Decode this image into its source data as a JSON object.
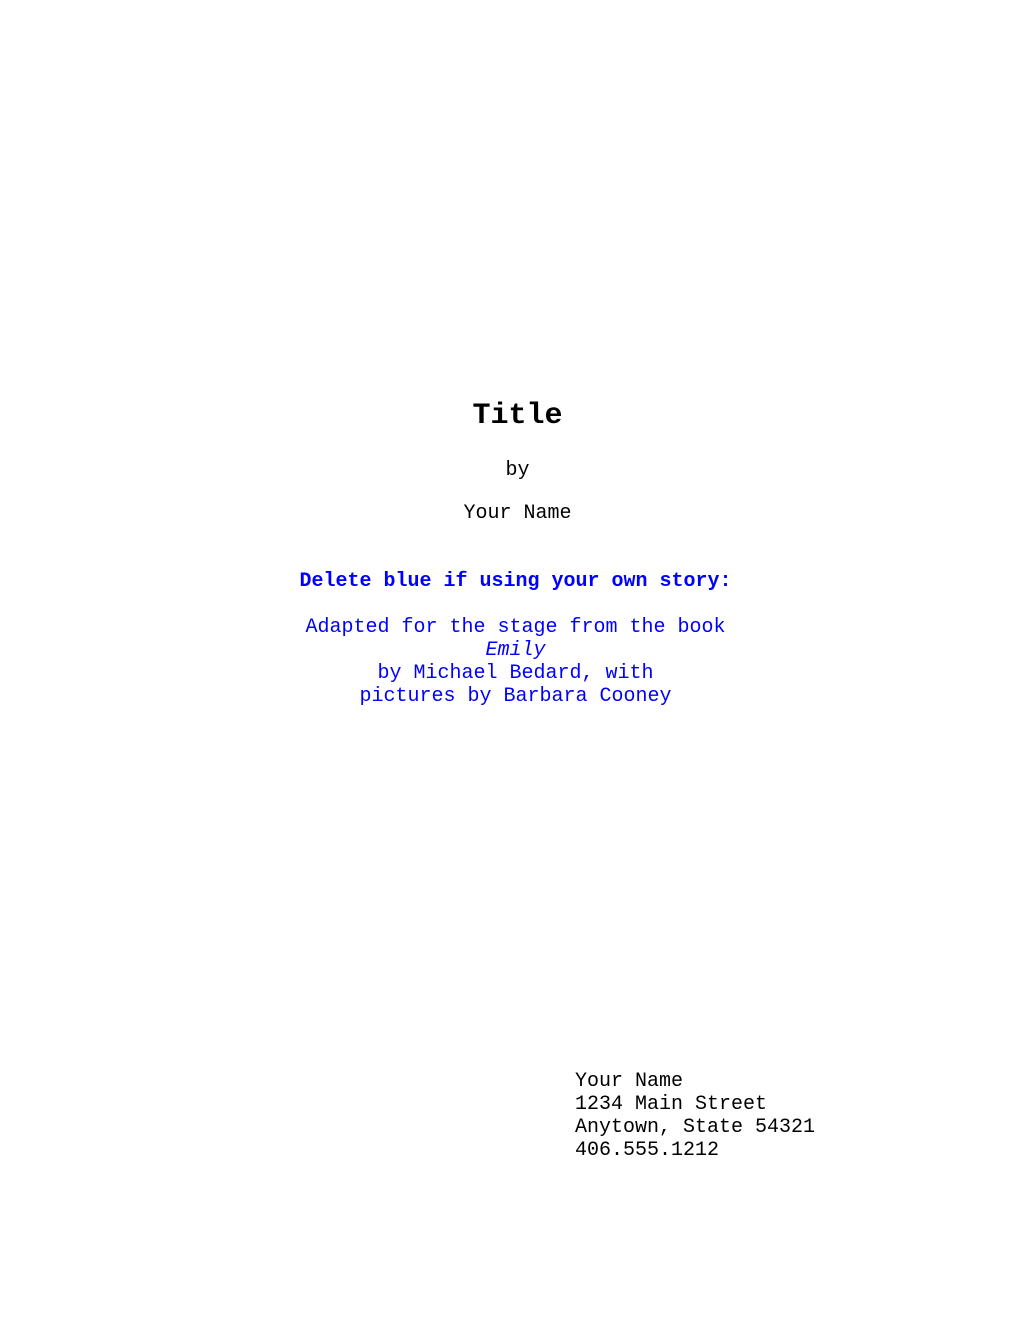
{
  "document": {
    "background_color": "#ffffff",
    "text_color": "#000000",
    "blue_color": "#0000ff"
  },
  "title_block": {
    "title": "Title",
    "by_label": "by",
    "author": "Your Name"
  },
  "blue_note": {
    "heading": "Delete blue if using your own story:",
    "lines": [
      "Adapted for the stage from the book",
      "Emily",
      "by Michael Bedard, with",
      "pictures by Barbara Cooney"
    ]
  },
  "contact_block": {
    "lines": [
      "Your Name",
      "1234 Main Street",
      "Anytown, State 54321",
      "406.555.1212"
    ]
  }
}
